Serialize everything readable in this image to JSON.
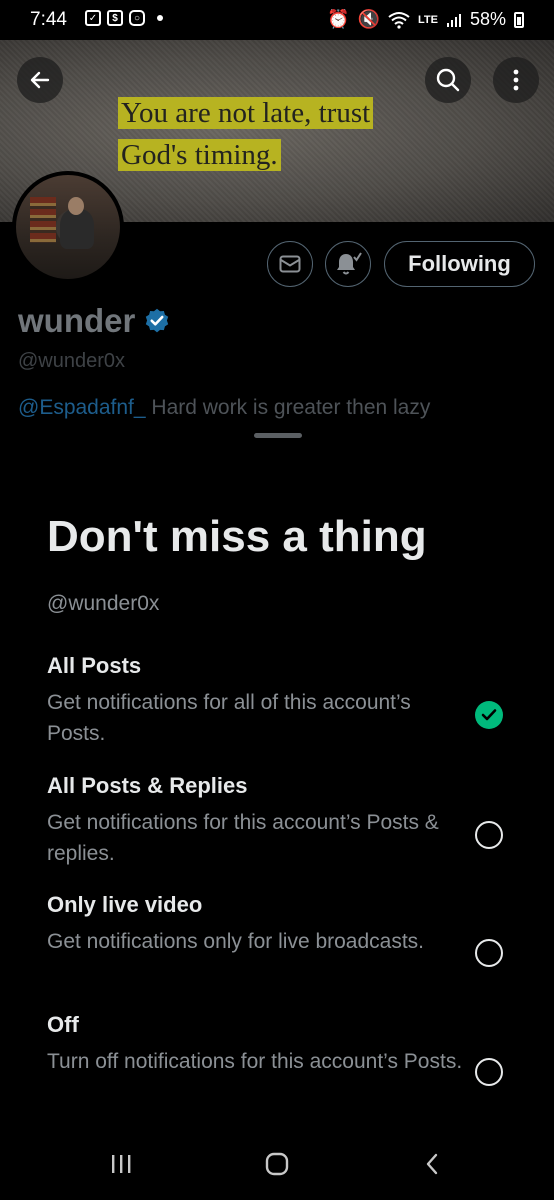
{
  "status_bar": {
    "time": "7:44",
    "battery": "58%",
    "network": "LTE"
  },
  "banner": {
    "quote_line1": "You are not late, trust",
    "quote_line2": "God's timing."
  },
  "profile": {
    "name": "wunder",
    "handle": "@wunder0x",
    "bio_mention": "@Espadafnf_",
    "bio_text": " Hard work is greater then lazy",
    "following_label": "Following"
  },
  "sheet": {
    "title": "Don't miss a thing",
    "handle": "@wunder0x",
    "options": [
      {
        "title": "All Posts",
        "description": "Get notifications for all of this account’s Posts.",
        "selected": true
      },
      {
        "title": "All Posts & Replies",
        "description": "Get notifications for this account’s Posts & replies.",
        "selected": false
      },
      {
        "title": "Only live video",
        "description": "Get notifications only for live broadcasts.",
        "selected": false
      },
      {
        "title": "Off",
        "description": "Turn off notifications for this account’s Posts.",
        "selected": false
      }
    ]
  },
  "colors": {
    "accent_green": "#00ba7c",
    "verified_blue": "#1d9bf0",
    "highlight": "#b7b321"
  },
  "icons": {
    "back": "arrow-left-icon",
    "search": "search-icon",
    "more": "more-vertical-icon",
    "message": "envelope-icon",
    "notify": "bell-check-icon",
    "verified": "verified-badge-icon",
    "check": "check-icon",
    "nav_recents": "recents-icon",
    "nav_home": "home-icon",
    "nav_back": "chevron-left-icon"
  }
}
